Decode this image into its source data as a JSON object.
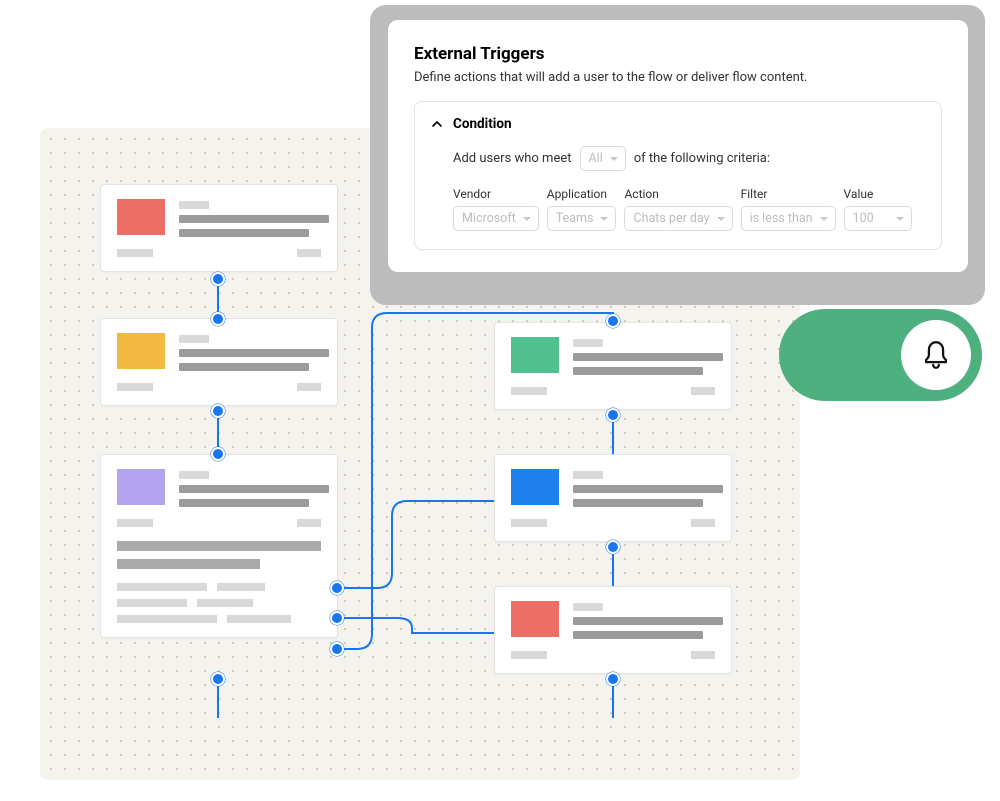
{
  "panel": {
    "title": "External Triggers",
    "subtitle": "Define actions that will add a user to the flow or deliver flow content.",
    "condition": {
      "heading": "Condition",
      "pre_text": "Add users who meet",
      "match_mode": "All",
      "post_text": "of the following criteria:",
      "fields": [
        {
          "label": "Vendor",
          "value": "Microsoft"
        },
        {
          "label": "Application",
          "value": "Teams"
        },
        {
          "label": "Action",
          "value": "Chats per day"
        },
        {
          "label": "Filter",
          "value": "is less than"
        },
        {
          "label": "Value",
          "value": "100"
        }
      ]
    }
  },
  "nodes": {
    "left": [
      {
        "color": "#ec6e64"
      },
      {
        "color": "#f2b83f"
      },
      {
        "color": "#b4a4ef",
        "expanded": true
      }
    ],
    "right": [
      {
        "color": "#52bf8e"
      },
      {
        "color": "#1e80ef"
      },
      {
        "color": "#ec6e64"
      }
    ]
  },
  "notification": {
    "icon": "bell-icon",
    "pill_color": "#4eaf7f"
  }
}
